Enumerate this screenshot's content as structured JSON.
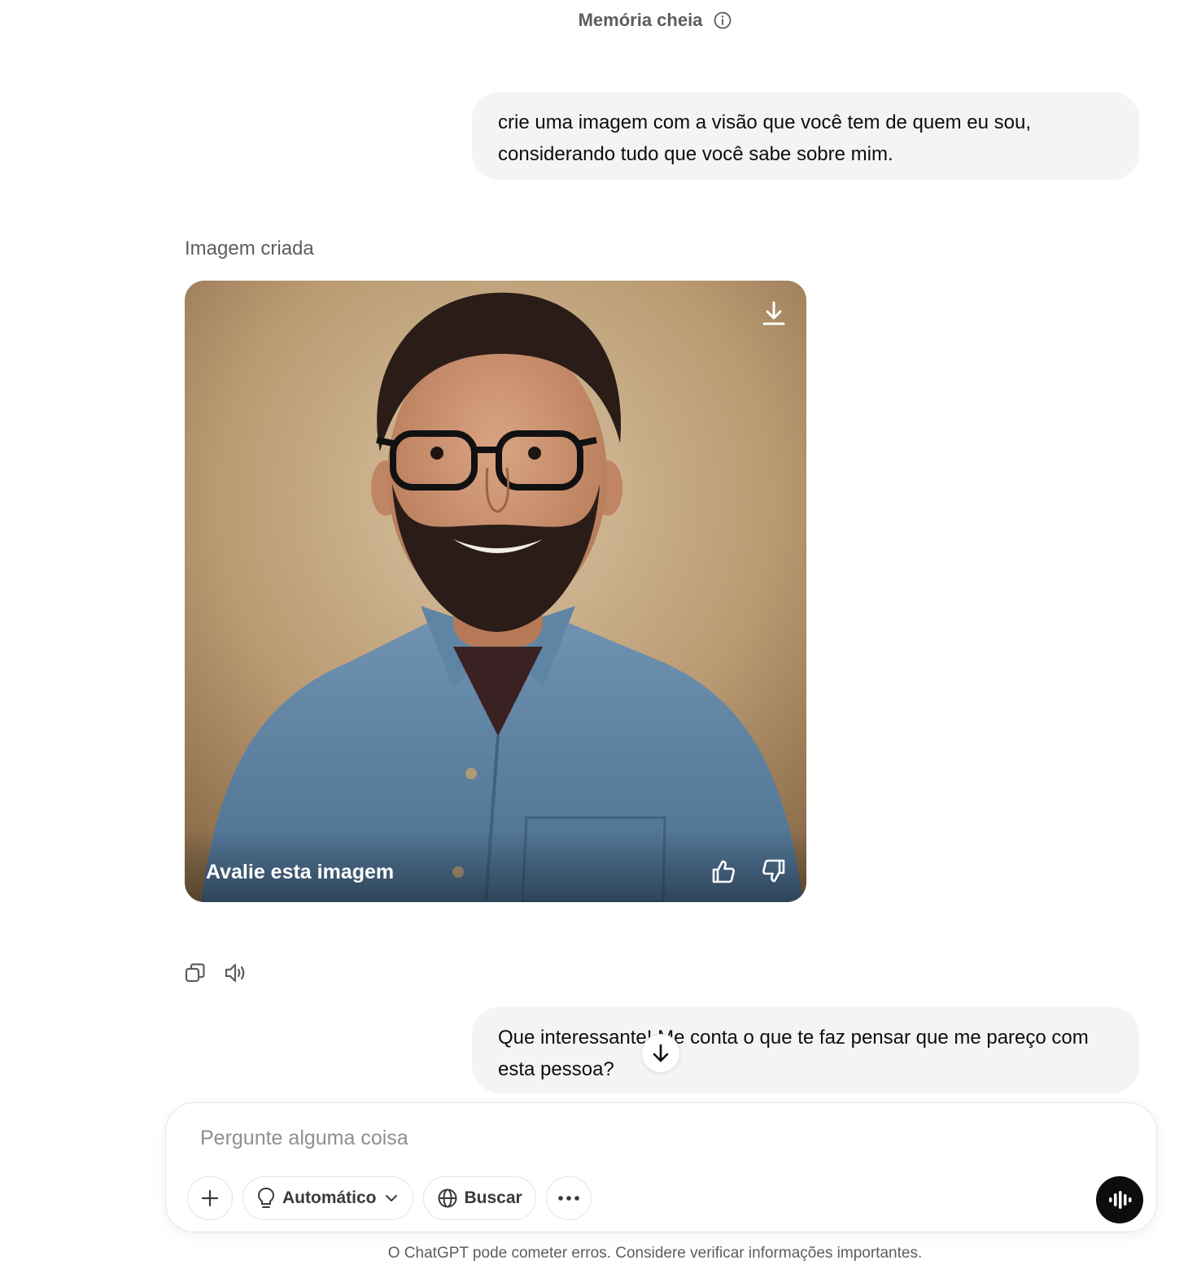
{
  "header": {
    "memory_label": "Memória cheia",
    "info_icon": "info-icon"
  },
  "messages": [
    {
      "role": "user",
      "text": "crie uma imagem com a visão que você tem de quem eu sou, considerando tudo que você sabe sobre mim."
    },
    {
      "role": "assistant",
      "label": "Imagem criada",
      "image": {
        "description": "Portrait of smiling bearded man with glasses and denim shirt",
        "rate_label": "Avalie esta imagem",
        "download_icon": "download-icon",
        "thumbs_up_icon": "thumbs-up-icon",
        "thumbs_down_icon": "thumbs-down-icon"
      },
      "actions": [
        "copy-icon",
        "read-aloud-icon"
      ]
    },
    {
      "role": "user",
      "text": "Que interessante! Me conta o que te faz pensar que me pareço com esta pessoa?"
    }
  ],
  "composer": {
    "placeholder": "Pergunte alguma coisa",
    "value": "",
    "add_icon": "plus-icon",
    "model_pill": "Automático",
    "search_pill": "Buscar",
    "more_icon": "more-dots-icon",
    "voice_icon": "voice-mode-icon"
  },
  "footer": {
    "disclaimer": "O ChatGPT pode cometer erros. Considere verificar informações importantes."
  },
  "colors": {
    "bubble_bg": "#f4f4f4",
    "text": "#0d0d0d",
    "muted": "#5d5d5d",
    "voice_btn": "#0d0d0d"
  }
}
